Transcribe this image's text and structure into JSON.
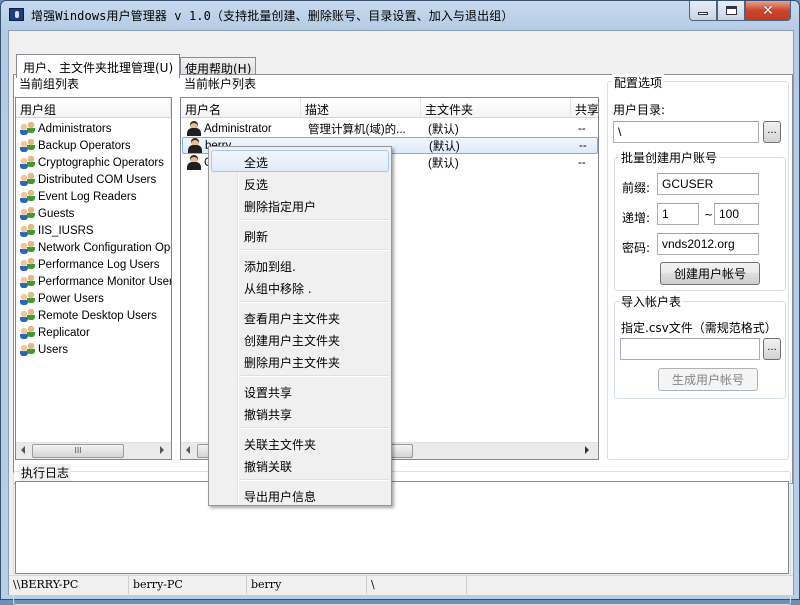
{
  "window": {
    "title": "增强Windows用户管理器 v 1.0（支持批量创建、删除账号、目录设置、加入与退出组）",
    "minimize": "minimize",
    "maximize": "maximize",
    "close": "close"
  },
  "tabs": [
    {
      "label": "用户、主文件夹批理管理(U)",
      "active": true
    },
    {
      "label": "使用帮助(H)",
      "active": false
    }
  ],
  "groups_panel": {
    "title": "当前组列表",
    "header": "用户组",
    "items": [
      "Administrators",
      "Backup Operators",
      "Cryptographic Operators",
      "Distributed COM Users",
      "Event Log Readers",
      "Guests",
      "IIS_IUSRS",
      "Network Configuration Operators",
      "Performance Log Users",
      "Performance Monitor Users",
      "Power Users",
      "Remote Desktop Users",
      "Replicator",
      "Users"
    ],
    "scroll_thumb": "III"
  },
  "accounts_panel": {
    "title": "当前帐户列表",
    "columns": [
      "用户名",
      "描述",
      "主文件夹",
      "共享"
    ],
    "rows": [
      {
        "name": "Administrator",
        "desc": "管理计算机(域)的...",
        "home": "(默认)",
        "share": "--",
        "selected": false
      },
      {
        "name": "berry",
        "desc": "",
        "home": "(默认)",
        "share": "--",
        "selected": true
      },
      {
        "name": "Guest",
        "desc": "...",
        "home": "(默认)",
        "share": "--",
        "selected": false
      }
    ]
  },
  "context_menu": {
    "groups": [
      [
        "全选",
        "反选",
        "删除指定用户"
      ],
      [
        "刷新"
      ],
      [
        "添加到组.",
        "从组中移除 ."
      ],
      [
        "查看用户主文件夹",
        "创建用户主文件夹",
        "删除用户主文件夹"
      ],
      [
        "设置共享",
        "撤销共享"
      ],
      [
        "关联主文件夹",
        "撤销关联"
      ],
      [
        "导出用户信息"
      ]
    ],
    "highlighted": "全选"
  },
  "config": {
    "title": "配置选项",
    "user_dir_label": "用户目录:",
    "user_dir_value": "\\",
    "browse": "...",
    "batch": {
      "title": "批量创建用户账号",
      "prefix_label": "前缀:",
      "prefix_value": "GCUSER",
      "increment_label": "递增:",
      "from_value": "1",
      "tilde": "~",
      "to_value": "100",
      "password_label": "密码:",
      "password_value": "vnds2012.org",
      "create_button": "创建用户帐号"
    },
    "import": {
      "title": "导入帐户表",
      "csv_label": "指定.csv文件（需规范格式）",
      "csv_value": "",
      "browse": "...",
      "generate_button": "生成用户帐号"
    }
  },
  "log": {
    "title": "执行日志"
  },
  "statusbar": [
    "\\\\BERRY-PC",
    "berry-PC",
    "berry",
    "\\",
    ""
  ]
}
